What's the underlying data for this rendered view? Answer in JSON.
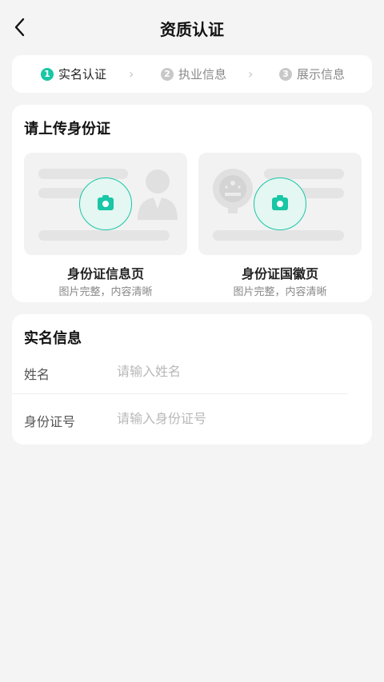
{
  "header": {
    "back_icon": "chevron-left-icon",
    "title": "资质认证"
  },
  "steps": [
    {
      "num": "1",
      "label": "实名认证",
      "state": "active"
    },
    {
      "num": "2",
      "label": "执业信息",
      "state": "inactive"
    },
    {
      "num": "3",
      "label": "展示信息",
      "state": "inactive"
    }
  ],
  "step_separator": "›",
  "upload": {
    "title": "请上传身份证",
    "front": {
      "caption": "身份证信息页",
      "hint": "图片完整，内容清晰",
      "icon": "camera-icon"
    },
    "back": {
      "caption": "身份证国徽页",
      "hint": "图片完整，内容清晰",
      "icon": "camera-icon"
    }
  },
  "realname": {
    "title": "实名信息",
    "name_label": "姓名",
    "name_placeholder": "请输入姓名",
    "id_label": "身份证号",
    "id_placeholder": "请输入身份证号"
  },
  "colors": {
    "accent": "#19c6a5",
    "background": "#f4f4f4",
    "card": "#ffffff"
  }
}
